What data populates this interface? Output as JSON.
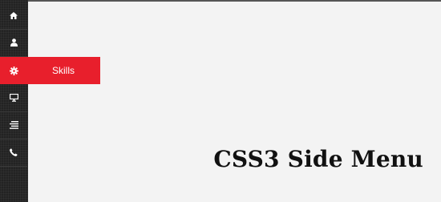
{
  "sidebar": {
    "items": [
      {
        "icon": "home-icon",
        "label": ""
      },
      {
        "icon": "user-icon",
        "label": ""
      },
      {
        "icon": "gear-icon",
        "label": "Skills"
      },
      {
        "icon": "desktop-icon",
        "label": ""
      },
      {
        "icon": "align-right-icon",
        "label": ""
      },
      {
        "icon": "phone-icon",
        "label": ""
      }
    ],
    "active_index": 2
  },
  "main": {
    "title": "CSS3 Side Menu"
  },
  "colors": {
    "sidebar_bg": "#232323",
    "active_item_bg": "#e81f2c",
    "page_bg": "#f3f3f3",
    "title": "#111111",
    "icon": "#ffffff"
  }
}
